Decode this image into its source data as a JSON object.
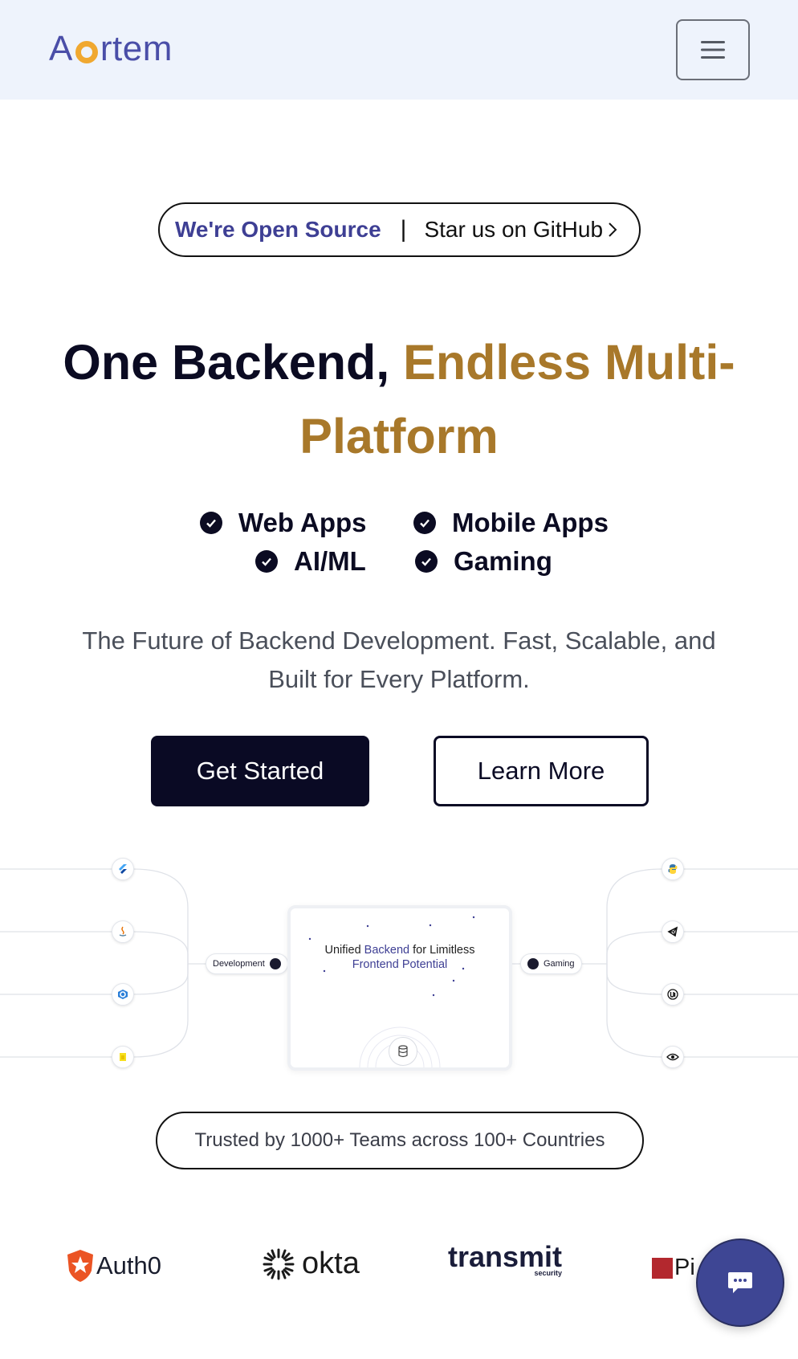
{
  "brand": {
    "logo_a": "A",
    "logo_rest": "rtem"
  },
  "header": {
    "menu_icon": "hamburger-menu-icon"
  },
  "oss_banner": {
    "open_source": "We're Open Source",
    "separator": "|",
    "github": "Star us on GitHub"
  },
  "hero": {
    "headline_dark": "One Backend, ",
    "headline_gold_1": "Endless Multi-",
    "headline_gold_2": "Platform",
    "features": [
      "Web Apps",
      "Mobile Apps",
      "AI/ML",
      "Gaming"
    ],
    "subtitle_1": "The Future of Backend Development. Fast, Scalable, and",
    "subtitle_2": "Built for Every Platform.",
    "get_started": "Get Started",
    "learn_more": "Learn More"
  },
  "diagram": {
    "left_chip": "Development",
    "right_chip": "Gaming",
    "card_line1_a": "Unified ",
    "card_line1_hl": "Backend",
    "card_line1_b": " for Limitless",
    "card_line2": "Frontend Potential",
    "left_icons": [
      "flutter-icon",
      "java-icon",
      "csharp-icon",
      "javascript-icon"
    ],
    "right_icons": [
      "python-icon",
      "unity-icon",
      "unreal-icon",
      "godot-icon"
    ]
  },
  "trust": {
    "text": "Trusted by 1000+ Teams across 100+ Countries"
  },
  "logos": {
    "auth0": "Auth0",
    "okta": "okta",
    "transmit": "transmit",
    "transmit_sub": "security",
    "pi": "Pi"
  },
  "colors": {
    "brand_indigo": "#3e3f94",
    "gold": "#a8782a",
    "navy": "#0a0a24",
    "logo_orange": "#f0a830"
  }
}
